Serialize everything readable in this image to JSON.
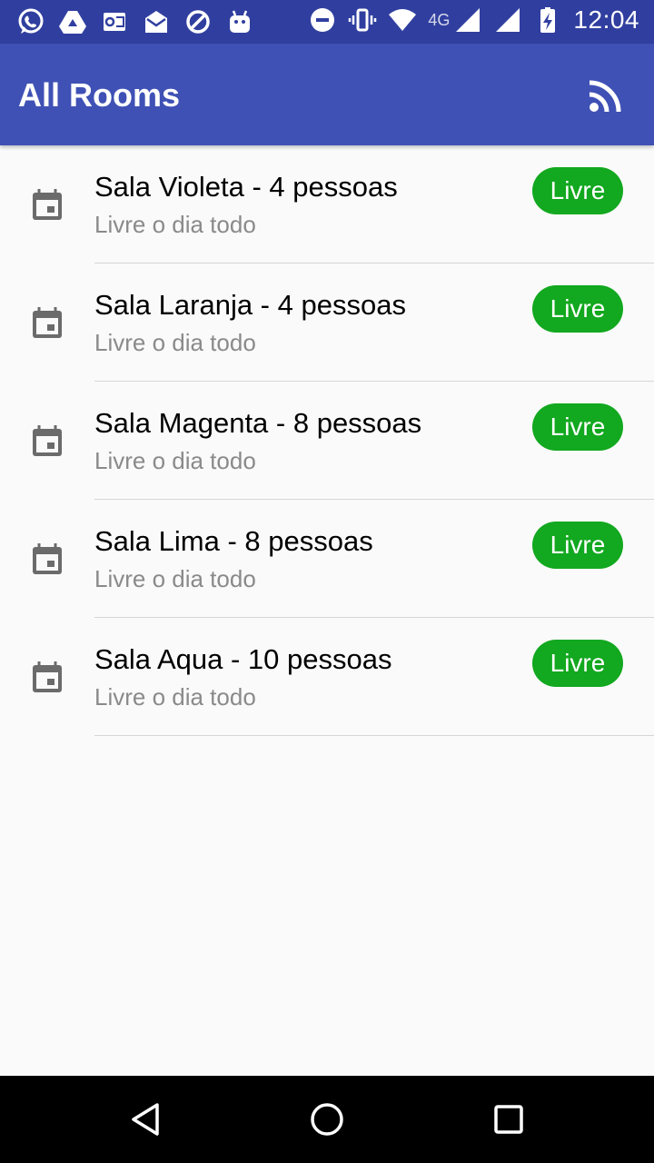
{
  "status_bar": {
    "time": "12:04",
    "network": "4G",
    "left_icons": [
      "whatsapp-icon",
      "drive-icon",
      "outlook-icon",
      "mail-icon",
      "block-icon",
      "android-icon"
    ],
    "right_icons": [
      "do-not-disturb-icon",
      "vibrate-icon",
      "wifi-icon",
      "signal-icon",
      "signal-icon",
      "battery-charging-icon"
    ]
  },
  "app_bar": {
    "title": "All Rooms",
    "cast_icon": "cast-feed-icon"
  },
  "rooms": [
    {
      "name": "Sala Violeta - 4 pessoas",
      "subtitle": "Livre o dia todo",
      "status": "Livre"
    },
    {
      "name": "Sala Laranja - 4 pessoas",
      "subtitle": "Livre o dia todo",
      "status": "Livre"
    },
    {
      "name": "Sala Magenta - 8 pessoas",
      "subtitle": "Livre o dia todo",
      "status": "Livre"
    },
    {
      "name": "Sala Lima - 8 pessoas",
      "subtitle": "Livre o dia todo",
      "status": "Livre"
    },
    {
      "name": "Sala Aqua - 10 pessoas",
      "subtitle": "Livre o dia todo",
      "status": "Livre"
    }
  ],
  "colors": {
    "status_bar": "#303f9f",
    "app_bar": "#3f51b5",
    "badge_free": "#12a81f",
    "subtitle": "#8a8a8a"
  },
  "nav": [
    "back-icon",
    "home-icon",
    "recents-icon"
  ]
}
